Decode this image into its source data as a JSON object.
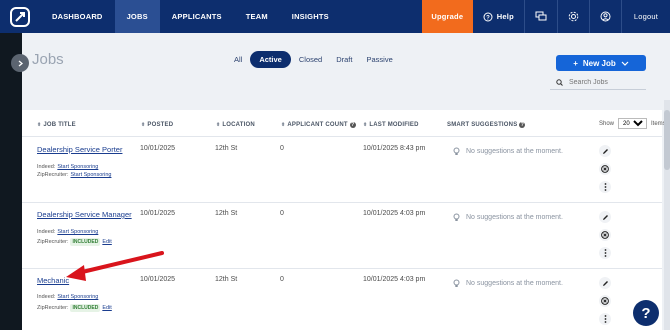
{
  "nav": {
    "items": [
      {
        "label": "DASHBOARD"
      },
      {
        "label": "JOBS"
      },
      {
        "label": "APPLICANTS"
      },
      {
        "label": "TEAM"
      },
      {
        "label": "INSIGHTS"
      }
    ],
    "upgrade": "Upgrade",
    "help": "Help",
    "logout": "Logout"
  },
  "page": {
    "title": "Jobs",
    "tabs": [
      "All",
      "Active",
      "Closed",
      "Draft",
      "Passive"
    ],
    "new_job": "New Job",
    "search_placeholder": "Search Jobs"
  },
  "table": {
    "headers": [
      "JOB TITLE",
      "POSTED",
      "LOCATION",
      "APPLICANT COUNT",
      "LAST MODIFIED",
      "SMART SUGGESTIONS"
    ],
    "show_label": "Show",
    "show_value": "20",
    "items_label": "Items",
    "indeed_label": "Indeed:",
    "zip_label": "ZipRecruiter:",
    "start_sponsoring": "Start Sponsoring",
    "included": "INCLUDED",
    "edit": "Edit",
    "rows": [
      {
        "title": "Dealership Service Porter",
        "posted": "10/01/2025",
        "location": "12th St",
        "count": "0",
        "modified": "10/01/2025 8:43 pm",
        "suggestion": "No suggestions at the moment."
      },
      {
        "title": "Dealership Service Manager",
        "posted": "10/01/2025",
        "location": "12th St",
        "count": "0",
        "modified": "10/01/2025 4:03 pm",
        "suggestion": "No suggestions at the moment."
      },
      {
        "title": "Mechanic",
        "posted": "10/01/2025",
        "location": "12th St",
        "count": "0",
        "modified": "10/01/2025 4:03 pm",
        "suggestion": "No suggestions at the moment."
      }
    ]
  },
  "colors": {
    "nav": "#0d2e6e",
    "upgrade": "#f26b1d",
    "primary": "#1565d8",
    "annotation": "#d9141c"
  }
}
